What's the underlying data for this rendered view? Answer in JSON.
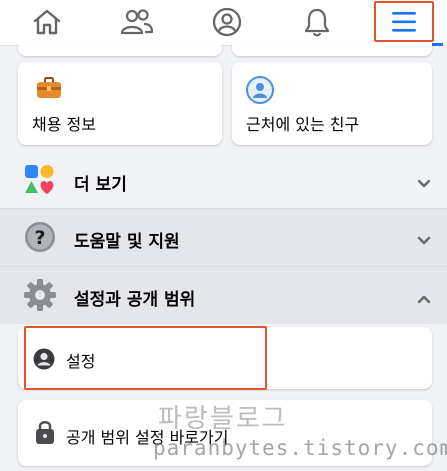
{
  "nav": {
    "items": [
      {
        "icon": "home-icon"
      },
      {
        "icon": "friends-icon"
      },
      {
        "icon": "profile-icon"
      },
      {
        "icon": "bell-icon"
      },
      {
        "icon": "menu-icon"
      }
    ],
    "accent": "#1877f2"
  },
  "shortcuts": [
    {
      "label": "채용 정보",
      "icon": "briefcase-icon"
    },
    {
      "label": "근처에 있는 친구",
      "icon": "nearby-friends-icon"
    }
  ],
  "sections": [
    {
      "label": "더 보기",
      "icon": "more-shapes-icon",
      "chevron": "chevron-down-icon"
    },
    {
      "label": "도움말 및 지원",
      "icon": "help-icon",
      "chevron": "chevron-down-icon"
    },
    {
      "label": "설정과 공개 범위",
      "icon": "gear-icon",
      "chevron": "chevron-up-icon"
    }
  ],
  "settings_items": [
    {
      "label": "설정",
      "icon": "user-settings-icon"
    },
    {
      "label": "공개 범위 설정 바로가기",
      "icon": "lock-icon"
    }
  ],
  "watermark": {
    "title": "파랑블로그",
    "url": "paranbytes.tistory.com"
  },
  "highlight_color": "#e0552e"
}
